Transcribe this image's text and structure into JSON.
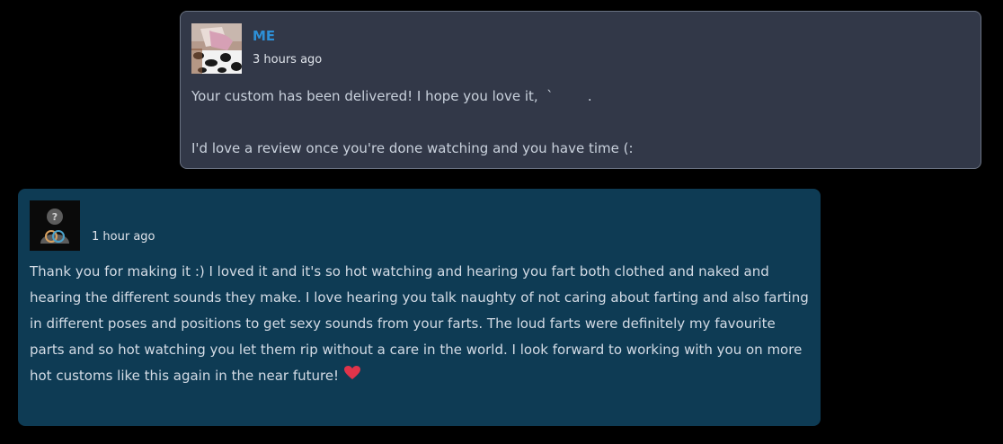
{
  "messages": {
    "mine": {
      "sender": "ME",
      "time": "3 hours ago",
      "text": "Your custom has been delivered! I hope you love it,  `        .\n\nI'd love a review once you're done watching and you have time (:",
      "avatar_icon": "profile-photo"
    },
    "theirs": {
      "time": "1 hour ago",
      "text": "Thank you for making it :) I loved it and it's so hot watching and hearing you fart both clothed and naked and hearing the different sounds they make. I love hearing you talk naughty of not caring about farting and also farting in different poses and positions to get sexy sounds from your farts. The loud farts were definitely my favourite parts and so hot watching you let them rip without a care in the world. I look forward to working with you on more hot customs like this again in the near future!",
      "avatar_icon": "default-user-icon",
      "emoji": "red-heart-icon"
    }
  },
  "colors": {
    "background": "#000000",
    "my_bubble": "#323848",
    "their_bubble": "#0e3b54",
    "sender_name": "#2d8fd6",
    "heart": "#e0344a"
  }
}
